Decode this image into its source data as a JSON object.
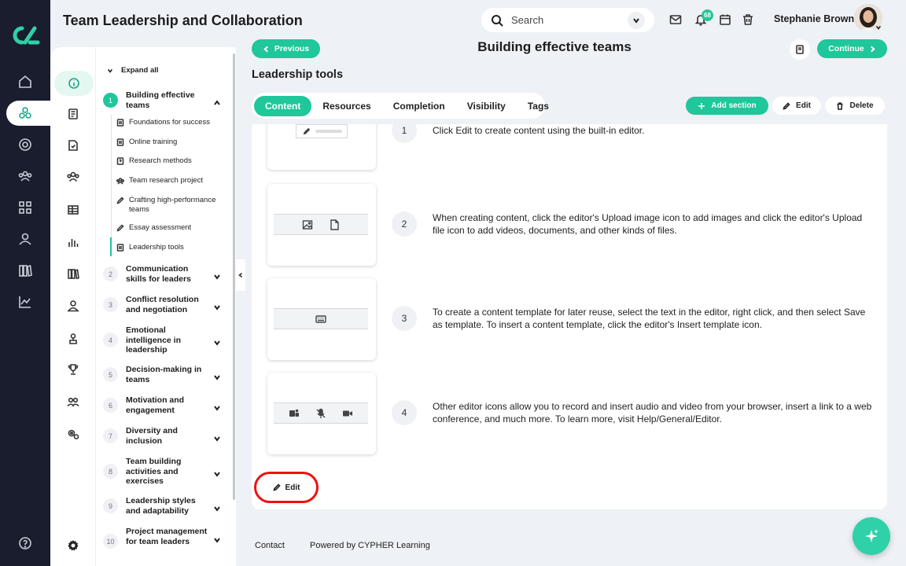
{
  "app": {
    "title": "Team Leadership and Collaboration"
  },
  "header": {
    "search_placeholder": "Search",
    "notifications_count": "68",
    "user_name": "Stephanie Brown"
  },
  "sidebar": {
    "expand_all": "Expand all",
    "modules": [
      {
        "num": "1",
        "title": "Building effective teams"
      },
      {
        "num": "2",
        "title": "Communication skills for leaders"
      },
      {
        "num": "3",
        "title": "Conflict resolution and negotiation"
      },
      {
        "num": "4",
        "title": "Emotional intelligence in leadership"
      },
      {
        "num": "5",
        "title": "Decision-making in teams"
      },
      {
        "num": "6",
        "title": "Motivation and engagement"
      },
      {
        "num": "7",
        "title": "Diversity and inclusion"
      },
      {
        "num": "8",
        "title": "Team building activities and exercises"
      },
      {
        "num": "9",
        "title": "Leadership styles and adaptability"
      },
      {
        "num": "10",
        "title": "Project management for team leaders"
      }
    ],
    "subitems": [
      {
        "label": "Foundations for success",
        "icon": "page-icon"
      },
      {
        "label": "Online training",
        "icon": "page-icon"
      },
      {
        "label": "Research methods",
        "icon": "question-page-icon"
      },
      {
        "label": "Team research project",
        "icon": "team-icon"
      },
      {
        "label": "Crafting high-performance teams",
        "icon": "pencil-icon"
      },
      {
        "label": "Essay assessment",
        "icon": "pencil-icon"
      },
      {
        "label": "Leadership tools",
        "icon": "page-icon"
      }
    ]
  },
  "main": {
    "previous_label": "Previous",
    "continue_label": "Continue",
    "page_title": "Building effective teams",
    "section_title": "Leadership tools",
    "tabs": [
      "Content",
      "Resources",
      "Completion",
      "Visibility",
      "Tags"
    ],
    "active_tab": "Content",
    "add_section_label": "Add section",
    "edit_label": "Edit",
    "delete_label": "Delete",
    "steps": [
      {
        "num": "1",
        "text": "Click Edit to create content using the built-in editor."
      },
      {
        "num": "2",
        "text": "When creating content, click the editor's Upload image icon to add images and click the editor's Upload file icon to add videos, documents, and other kinds of files."
      },
      {
        "num": "3",
        "text": "To create a content template for later reuse, select the text in the editor, right click, and then select Save as template. To insert a content template, click the editor's Insert template icon."
      },
      {
        "num": "4",
        "text": "Other editor icons allow you to record and insert audio and video from your browser, insert a link to a web conference, and much more. To learn more, visit Help/General/Editor."
      }
    ],
    "bottom_edit_label": "Edit"
  },
  "footer": {
    "contact": "Contact",
    "powered_by": "Powered by CYPHER Learning"
  },
  "colors": {
    "accent": "#1fc79a",
    "rail": "#1a1d2e",
    "highlight": "#e11111"
  }
}
